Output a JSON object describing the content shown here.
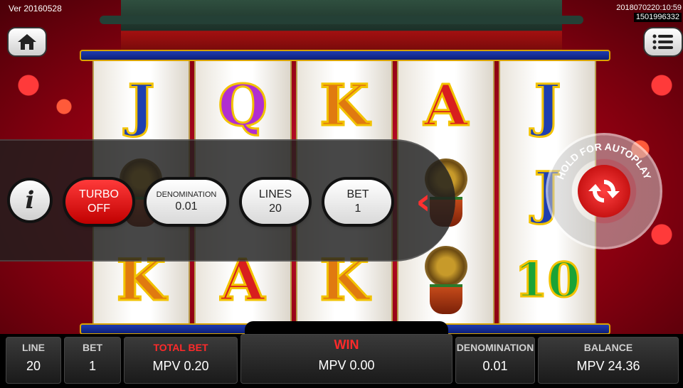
{
  "version_label": "Ver 20160528",
  "session": {
    "timestamp": "2018070220:10:59",
    "id": "1501996332"
  },
  "reels": [
    [
      {
        "glyph": "J",
        "cls": "g-j"
      },
      {
        "glyph": "",
        "cls": "tree"
      },
      {
        "glyph": "K",
        "cls": "g-k"
      }
    ],
    [
      {
        "glyph": "Q",
        "cls": "g-q"
      },
      {
        "glyph": "",
        "cls": "blank"
      },
      {
        "glyph": "A",
        "cls": "g-a"
      }
    ],
    [
      {
        "glyph": "K",
        "cls": "g-k"
      },
      {
        "glyph": "",
        "cls": "blank"
      },
      {
        "glyph": "K",
        "cls": "g-k"
      }
    ],
    [
      {
        "glyph": "A",
        "cls": "g-a"
      },
      {
        "glyph": "",
        "cls": "tree"
      },
      {
        "glyph": "",
        "cls": "tree"
      }
    ],
    [
      {
        "glyph": "J",
        "cls": "g-j"
      },
      {
        "glyph": "J",
        "cls": "g-j"
      },
      {
        "glyph": "10",
        "cls": "g-10"
      }
    ]
  ],
  "panel": {
    "info_icon": "info-icon",
    "turbo": {
      "line1": "TURBO",
      "line2": "OFF"
    },
    "denomination": {
      "label": "DENOMINATION",
      "value": "0.01"
    },
    "lines": {
      "label": "LINES",
      "value": "20"
    },
    "bet": {
      "label": "BET",
      "value": "1"
    },
    "collapse_icon": "chevron-left-icon"
  },
  "autoplay": {
    "label": "HOLD FOR AUTOPLAY",
    "icon": "spin-icon"
  },
  "footer": {
    "line": {
      "label": "LINE",
      "value": "20"
    },
    "bet": {
      "label": "BET",
      "value": "1"
    },
    "total_bet": {
      "label": "TOTAL BET",
      "value": "MPV 0.20"
    },
    "win": {
      "label": "WIN",
      "value": "MPV 0.00"
    },
    "denomination": {
      "label": "DENOMINATION",
      "value": "0.01"
    },
    "balance": {
      "label": "BALANCE",
      "value": "MPV 24.36"
    }
  },
  "colors": {
    "accent_red": "#ff2a2a",
    "reel_frame_gold": "#d9a400",
    "bar_blue": "#1f3cb0"
  }
}
